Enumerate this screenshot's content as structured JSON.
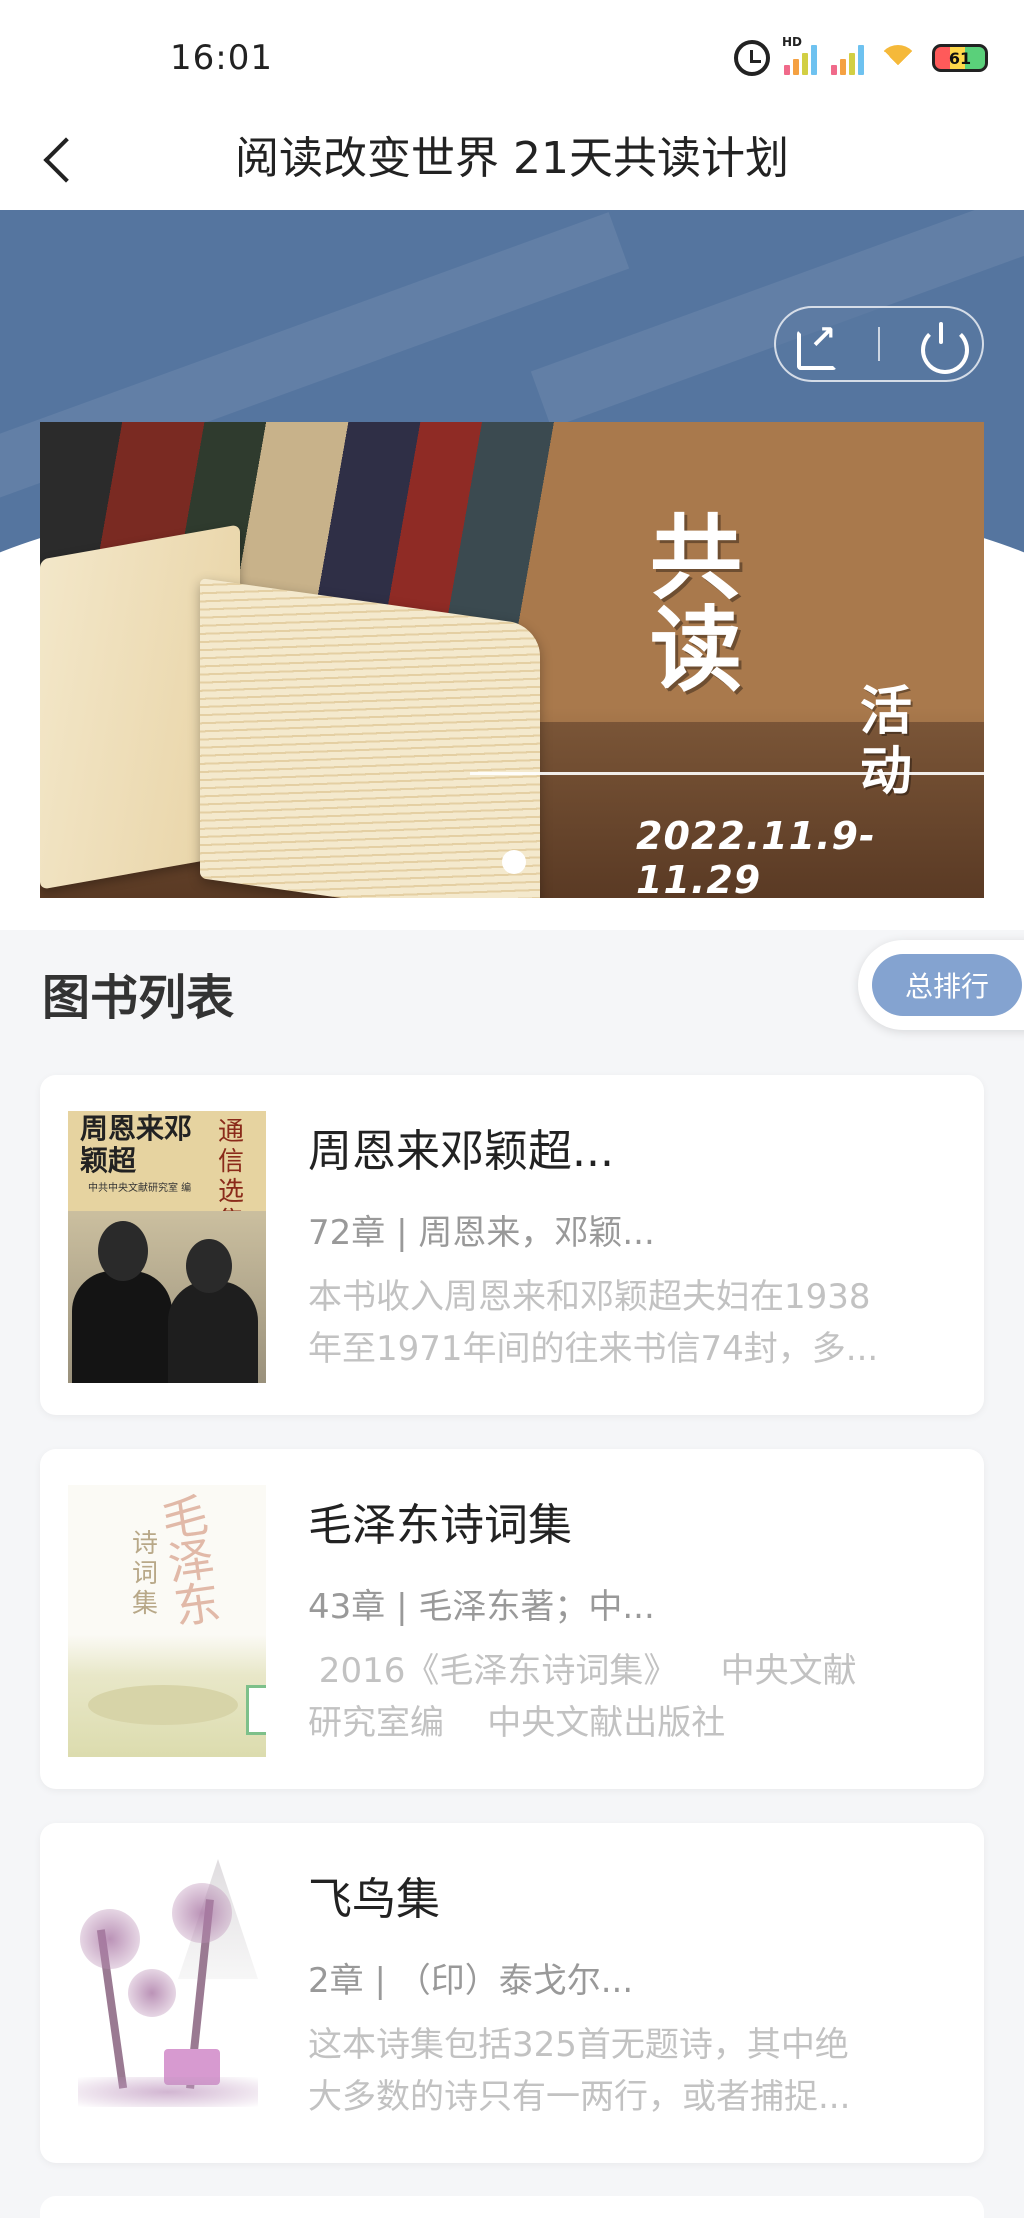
{
  "status_bar": {
    "time": "16:01",
    "icons": [
      "alarm-icon",
      "signal-hd-icon",
      "signal-icon",
      "wifi-icon",
      "battery-icon"
    ],
    "hd_label": "HD",
    "battery_level": "61"
  },
  "header": {
    "back_icon": "chevron-left-icon",
    "title": "阅读改变世界 21天共读计划"
  },
  "hero": {
    "actions": [
      "share-icon",
      "power-icon"
    ],
    "banner": {
      "title_big": "共读",
      "title_small": "活动",
      "date": "2022.11.9-11.29",
      "carousel_active_index": 0
    }
  },
  "book_list": {
    "title": "图书列表",
    "rank_button": "总排行",
    "books": [
      {
        "title": "周恩来邓颖超...",
        "meta": "72章 | 周恩来，邓颖...",
        "desc_line1": "本书收入周恩来和邓颖超夫妇在1938",
        "desc_line2": "年至1971年间的往来书信74封，多...",
        "cover_title": "周恩来邓颖超",
        "cover_side": "通信选集",
        "cover_publisher": "中共中央文献研究室 编"
      },
      {
        "title": "毛泽东诗词集",
        "meta": "43章 | 毛泽东著；中...",
        "desc_line1": " 2016《毛泽东诗词集》    中央文献",
        "desc_line2": "研究室编    中央文献出版社",
        "cover_title": "诗词集",
        "cover_callig": "毛泽东"
      },
      {
        "title": "飞鸟集",
        "meta": "2章 | （印）泰戈尔...",
        "desc_line1": "这本诗集包括325首无题诗，其中绝",
        "desc_line2": "大多数的诗只有一两行，或者捕捉..."
      }
    ]
  },
  "colors": {
    "hero_blue": "#55759f",
    "rank_button": "#84a3d0",
    "page_bg": "#f5f6f8"
  }
}
